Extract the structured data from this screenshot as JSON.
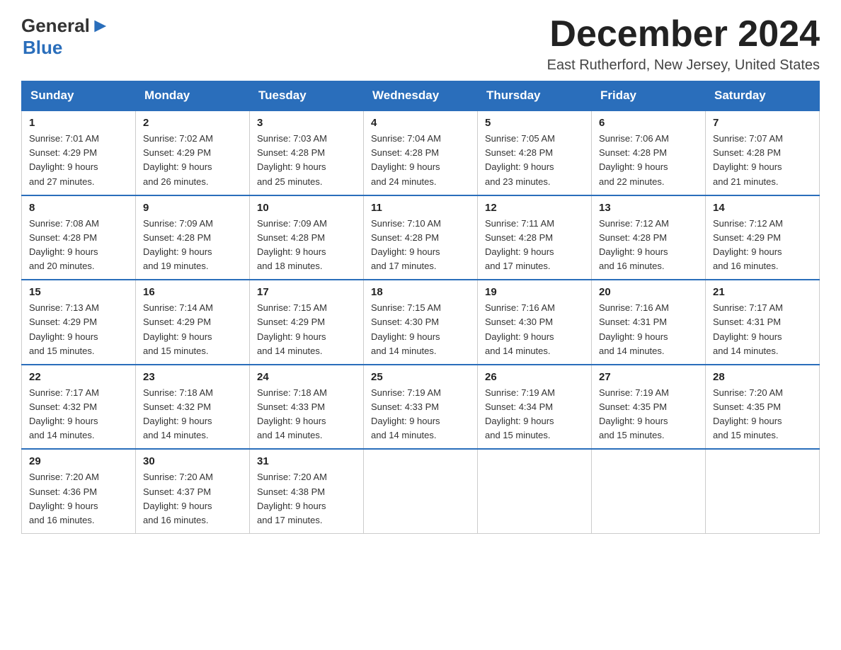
{
  "logo": {
    "general": "General",
    "blue": "Blue"
  },
  "title": "December 2024",
  "subtitle": "East Rutherford, New Jersey, United States",
  "days_of_week": [
    "Sunday",
    "Monday",
    "Tuesday",
    "Wednesday",
    "Thursday",
    "Friday",
    "Saturday"
  ],
  "weeks": [
    [
      {
        "day": "1",
        "sunrise": "7:01 AM",
        "sunset": "4:29 PM",
        "daylight": "9 hours and 27 minutes."
      },
      {
        "day": "2",
        "sunrise": "7:02 AM",
        "sunset": "4:29 PM",
        "daylight": "9 hours and 26 minutes."
      },
      {
        "day": "3",
        "sunrise": "7:03 AM",
        "sunset": "4:28 PM",
        "daylight": "9 hours and 25 minutes."
      },
      {
        "day": "4",
        "sunrise": "7:04 AM",
        "sunset": "4:28 PM",
        "daylight": "9 hours and 24 minutes."
      },
      {
        "day": "5",
        "sunrise": "7:05 AM",
        "sunset": "4:28 PM",
        "daylight": "9 hours and 23 minutes."
      },
      {
        "day": "6",
        "sunrise": "7:06 AM",
        "sunset": "4:28 PM",
        "daylight": "9 hours and 22 minutes."
      },
      {
        "day": "7",
        "sunrise": "7:07 AM",
        "sunset": "4:28 PM",
        "daylight": "9 hours and 21 minutes."
      }
    ],
    [
      {
        "day": "8",
        "sunrise": "7:08 AM",
        "sunset": "4:28 PM",
        "daylight": "9 hours and 20 minutes."
      },
      {
        "day": "9",
        "sunrise": "7:09 AM",
        "sunset": "4:28 PM",
        "daylight": "9 hours and 19 minutes."
      },
      {
        "day": "10",
        "sunrise": "7:09 AM",
        "sunset": "4:28 PM",
        "daylight": "9 hours and 18 minutes."
      },
      {
        "day": "11",
        "sunrise": "7:10 AM",
        "sunset": "4:28 PM",
        "daylight": "9 hours and 17 minutes."
      },
      {
        "day": "12",
        "sunrise": "7:11 AM",
        "sunset": "4:28 PM",
        "daylight": "9 hours and 17 minutes."
      },
      {
        "day": "13",
        "sunrise": "7:12 AM",
        "sunset": "4:28 PM",
        "daylight": "9 hours and 16 minutes."
      },
      {
        "day": "14",
        "sunrise": "7:12 AM",
        "sunset": "4:29 PM",
        "daylight": "9 hours and 16 minutes."
      }
    ],
    [
      {
        "day": "15",
        "sunrise": "7:13 AM",
        "sunset": "4:29 PM",
        "daylight": "9 hours and 15 minutes."
      },
      {
        "day": "16",
        "sunrise": "7:14 AM",
        "sunset": "4:29 PM",
        "daylight": "9 hours and 15 minutes."
      },
      {
        "day": "17",
        "sunrise": "7:15 AM",
        "sunset": "4:29 PM",
        "daylight": "9 hours and 14 minutes."
      },
      {
        "day": "18",
        "sunrise": "7:15 AM",
        "sunset": "4:30 PM",
        "daylight": "9 hours and 14 minutes."
      },
      {
        "day": "19",
        "sunrise": "7:16 AM",
        "sunset": "4:30 PM",
        "daylight": "9 hours and 14 minutes."
      },
      {
        "day": "20",
        "sunrise": "7:16 AM",
        "sunset": "4:31 PM",
        "daylight": "9 hours and 14 minutes."
      },
      {
        "day": "21",
        "sunrise": "7:17 AM",
        "sunset": "4:31 PM",
        "daylight": "9 hours and 14 minutes."
      }
    ],
    [
      {
        "day": "22",
        "sunrise": "7:17 AM",
        "sunset": "4:32 PM",
        "daylight": "9 hours and 14 minutes."
      },
      {
        "day": "23",
        "sunrise": "7:18 AM",
        "sunset": "4:32 PM",
        "daylight": "9 hours and 14 minutes."
      },
      {
        "day": "24",
        "sunrise": "7:18 AM",
        "sunset": "4:33 PM",
        "daylight": "9 hours and 14 minutes."
      },
      {
        "day": "25",
        "sunrise": "7:19 AM",
        "sunset": "4:33 PM",
        "daylight": "9 hours and 14 minutes."
      },
      {
        "day": "26",
        "sunrise": "7:19 AM",
        "sunset": "4:34 PM",
        "daylight": "9 hours and 15 minutes."
      },
      {
        "day": "27",
        "sunrise": "7:19 AM",
        "sunset": "4:35 PM",
        "daylight": "9 hours and 15 minutes."
      },
      {
        "day": "28",
        "sunrise": "7:20 AM",
        "sunset": "4:35 PM",
        "daylight": "9 hours and 15 minutes."
      }
    ],
    [
      {
        "day": "29",
        "sunrise": "7:20 AM",
        "sunset": "4:36 PM",
        "daylight": "9 hours and 16 minutes."
      },
      {
        "day": "30",
        "sunrise": "7:20 AM",
        "sunset": "4:37 PM",
        "daylight": "9 hours and 16 minutes."
      },
      {
        "day": "31",
        "sunrise": "7:20 AM",
        "sunset": "4:38 PM",
        "daylight": "9 hours and 17 minutes."
      },
      null,
      null,
      null,
      null
    ]
  ],
  "labels": {
    "sunrise": "Sunrise:",
    "sunset": "Sunset:",
    "daylight": "Daylight:"
  }
}
